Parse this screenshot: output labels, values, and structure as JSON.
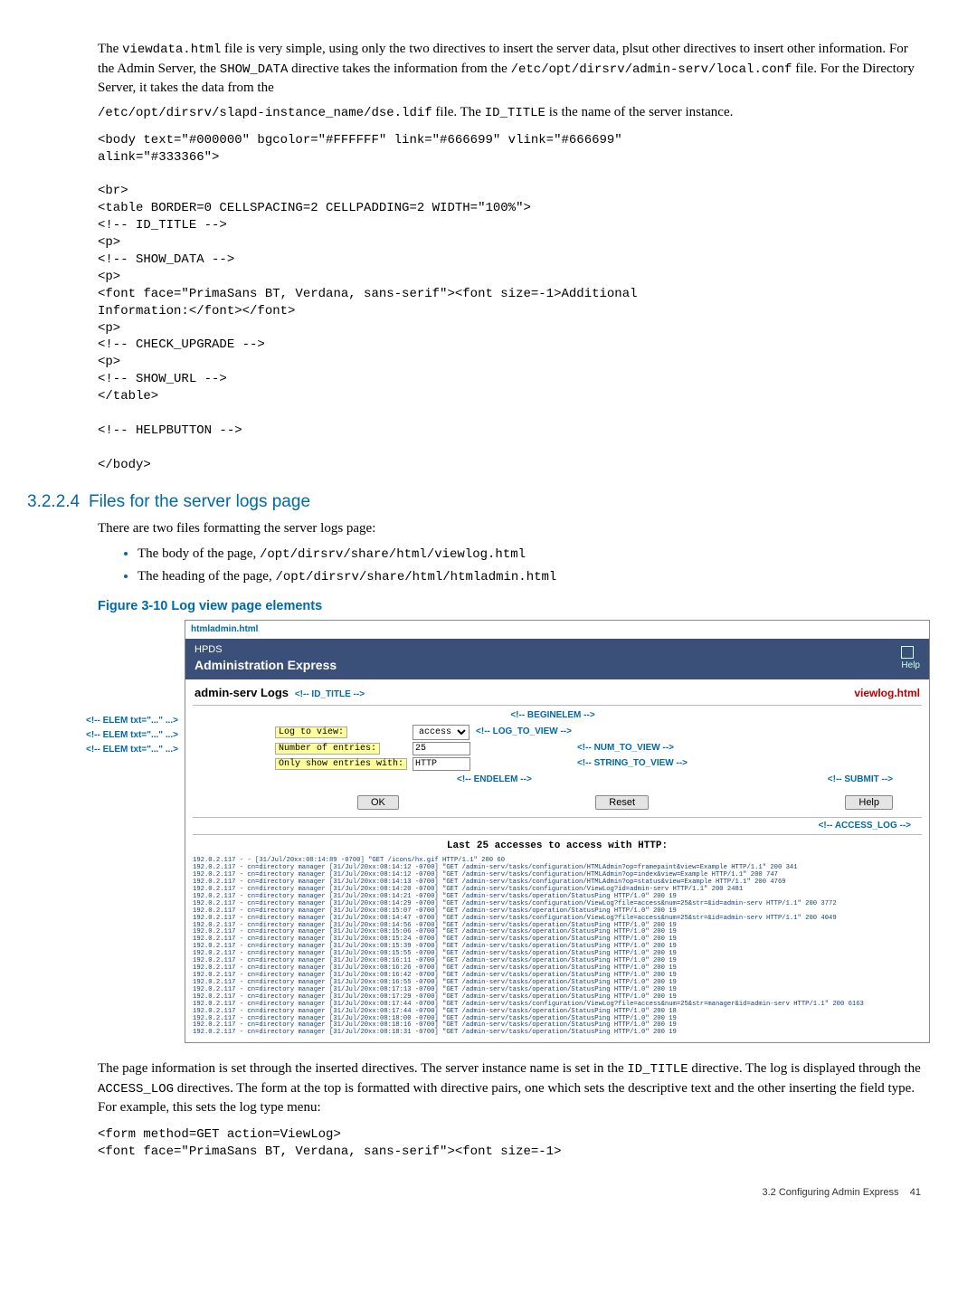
{
  "intro": {
    "p1a": "The ",
    "p1b": "viewdata.html",
    "p1c": " file is very simple, using only the two directives to insert the server data, plsut other directives to insert other information. For the Admin Server, the ",
    "p1d": "SHOW_DATA",
    "p1e": " directive takes the information from the ",
    "p1f": "/etc/opt/dirsrv/admin-serv/local.conf",
    "p1g": " file. For the Directory Server, it takes the data from the",
    "p2a": "/etc/opt/dirsrv/slapd-instance_name/dse.ldif",
    "p2b": " file. The ",
    "p2c": "ID_TITLE",
    "p2d": " is the name of the server instance."
  },
  "code1": "<body text=\"#000000\" bgcolor=\"#FFFFFF\" link=\"#666699\" vlink=\"#666699\"\nalink=\"#333366\">\n\n<br>\n<table BORDER=0 CELLSPACING=2 CELLPADDING=2 WIDTH=\"100%\">\n<!-- ID_TITLE -->\n<p>\n<!-- SHOW_DATA -->\n<p>\n<font face=\"PrimaSans BT, Verdana, sans-serif\"><font size=-1>Additional\nInformation:</font></font>\n<p>\n<!-- CHECK_UPGRADE -->\n<p>\n<!-- SHOW_URL -->\n</table>\n\n<!-- HELPBUTTON -->\n\n</body>",
  "section": {
    "num": "3.2.2.4",
    "title": "Files for the server logs page"
  },
  "after_heading": "There are two files formatting the server logs page:",
  "bullets": {
    "b1a": "The body of the page, ",
    "b1b": "/opt/dirsrv/share/html/viewlog.html",
    "b2a": "The heading of the page, ",
    "b2b": "/opt/dirsrv/share/html/htmladmin.html"
  },
  "fig_title": "Figure 3-10 Log view page elements",
  "fig": {
    "htmladmin_label": "htmladmin.html",
    "hpds": "HPDS",
    "admin_exp": "Administration Express",
    "help_link": "Help",
    "logs_label": "admin-serv Logs",
    "id_title_annot": "<!-- ID_TITLE -->",
    "viewlog_label": "viewlog.html",
    "elem_annot": "<!-- ELEM txt=\"...\" ...>",
    "log_to_view_lbl": "Log to view:",
    "log_to_view_val": "access",
    "log_to_view_annot": "<!-- LOG_TO_VIEW -->",
    "num_lbl": "Number of entries:",
    "num_val": "25",
    "num_annot": "<!-- NUM_TO_VIEW -->",
    "only_lbl": "Only show entries with:",
    "only_val": "HTTP",
    "only_annot": "<!-- STRING_TO_VIEW -->",
    "beginelem": "<!-- BEGINELEM -->",
    "endelem": "<!-- ENDELEM -->",
    "submit_annot": "<!-- SUBMIT -->",
    "access_log_annot": "<!-- ACCESS_LOG -->",
    "ok": "OK",
    "reset": "Reset",
    "help": "Help",
    "result_head": "Last 25 accesses to access with HTTP:",
    "log_lines": "192.0.2.117 - - [31/Jul/20xx:08:14:89 -0700] \"GET /icons/hx.gif HTTP/1.1\" 200 60\n192.0.2.117 - cn=directory manager [31/Jul/20xx:08:14:12 -0700] \"GET /admin-serv/tasks/configuration/HTMLAdmin?op=framepaint&view=Example HTTP/1.1\" 200 341\n192.0.2.117 - cn=directory manager [31/Jul/20xx:08:14:12 -0700] \"GET /admin-serv/tasks/configuration/HTMLAdmin?op=index&view=Example HTTP/1.1\" 200 747\n192.0.2.117 - cn=directory manager [31/Jul/20xx:08:14:13 -0700] \"GET /admin-serv/tasks/configuration/HTMLAdmin?op=status&view=Example HTTP/1.1\" 200 4769\n192.0.2.117 - cn=directory manager [31/Jul/20xx:08:14:20 -0700] \"GET /admin-serv/tasks/configuration/ViewLog?id=admin-serv HTTP/1.1\" 200 2481\n192.0.2.117 - cn=directory manager [31/Jul/20xx:08:14:21 -0700] \"GET /admin-serv/tasks/operation/StatusPing HTTP/1.0\" 200 19\n192.0.2.117 - cn=directory manager [31/Jul/20xx:08:14:29 -0700] \"GET /admin-serv/tasks/configuration/ViewLog?file=access&num=25&str=&id=admin-serv HTTP/1.1\" 200 3772\n192.0.2.117 - cn=directory manager [31/Jul/20xx:08:15:07 -0700] \"GET /admin-serv/tasks/operation/StatusPing HTTP/1.0\" 200 19\n192.0.2.117 - cn=directory manager [31/Jul/20xx:08:14:47 -0700] \"GET /admin-serv/tasks/configuration/ViewLog?file=access&num=25&str=&id=admin-serv HTTP/1.1\" 200 4049\n192.0.2.117 - cn=directory manager [31/Jul/20xx:08:14:56 -0700] \"GET /admin-serv/tasks/operation/StatusPing HTTP/1.0\" 200 19\n192.0.2.117 - cn=directory manager [31/Jul/20xx:08:15:06 -0700] \"GET /admin-serv/tasks/operation/StatusPing HTTP/1.0\" 200 19\n192.0.2.117 - cn=directory manager [31/Jul/20xx:08:15:24 -0700] \"GET /admin-serv/tasks/operation/StatusPing HTTP/1.0\" 200 19\n192.0.2.117 - cn=directory manager [31/Jul/20xx:08:15:39 -0700] \"GET /admin-serv/tasks/operation/StatusPing HTTP/1.0\" 200 19\n192.0.2.117 - cn=directory manager [31/Jul/20xx:08:15:55 -0700] \"GET /admin-serv/tasks/operation/StatusPing HTTP/1.0\" 200 19\n192.0.2.117 - cn=directory manager [31/Jul/20xx:08:16:11 -0700] \"GET /admin-serv/tasks/operation/StatusPing HTTP/1.0\" 200 19\n192.0.2.117 - cn=directory manager [31/Jul/20xx:08:16:26 -0700] \"GET /admin-serv/tasks/operation/StatusPing HTTP/1.0\" 200 19\n192.0.2.117 - cn=directory manager [31/Jul/20xx:08:16:42 -0700] \"GET /admin-serv/tasks/operation/StatusPing HTTP/1.0\" 200 19\n192.0.2.117 - cn=directory manager [31/Jul/20xx:08:16:55 -0700] \"GET /admin-serv/tasks/operation/StatusPing HTTP/1.0\" 200 19\n192.0.2.117 - cn=directory manager [31/Jul/20xx:08:17:13 -0700] \"GET /admin-serv/tasks/operation/StatusPing HTTP/1.0\" 200 19\n192.0.2.117 - cn=directory manager [31/Jul/20xx:08:17:29 -0700] \"GET /admin-serv/tasks/operation/StatusPing HTTP/1.0\" 200 19\n192.0.2.117 - cn=directory manager [31/Jul/20xx:08:17:44 -0700] \"GET /admin-serv/tasks/configuration/ViewLog?file=access&num=25&str=manager&id=admin-serv HTTP/1.1\" 200 6163\n192.0.2.117 - cn=directory manager [31/Jul/20xx:08:17:44 -0700] \"GET /admin-serv/tasks/operation/StatusPing HTTP/1.0\" 200 18\n192.0.2.117 - cn=directory manager [31/Jul/20xx:08:18:00 -0700] \"GET /admin-serv/tasks/operation/StatusPing HTTP/1.0\" 200 19\n192.0.2.117 - cn=directory manager [31/Jul/20xx:08:18:16 -0700] \"GET /admin-serv/tasks/operation/StatusPing HTTP/1.0\" 200 19\n192.0.2.117 - cn=directory manager [31/Jul/20xx:08:18:31 -0700] \"GET /admin-serv/tasks/operation/StatusPing HTTP/1.0\" 200 19"
  },
  "after_fig": {
    "p1a": "The page information is set through the inserted directives. The server instance name is set in the ",
    "p1b": "ID_TITLE",
    "p1c": " directive. The log is displayed through the ",
    "p1d": "ACCESS_LOG",
    "p1e": " directives. The form at the top is formatted with directive pairs, one which sets the descriptive text and the other inserting the field type. For example, this sets the log type menu:"
  },
  "code2": "<form method=GET action=ViewLog>\n<font face=\"PrimaSans BT, Verdana, sans-serif\"><font size=-1>",
  "footer": {
    "section": "3.2 Configuring Admin Express",
    "page": "41"
  }
}
